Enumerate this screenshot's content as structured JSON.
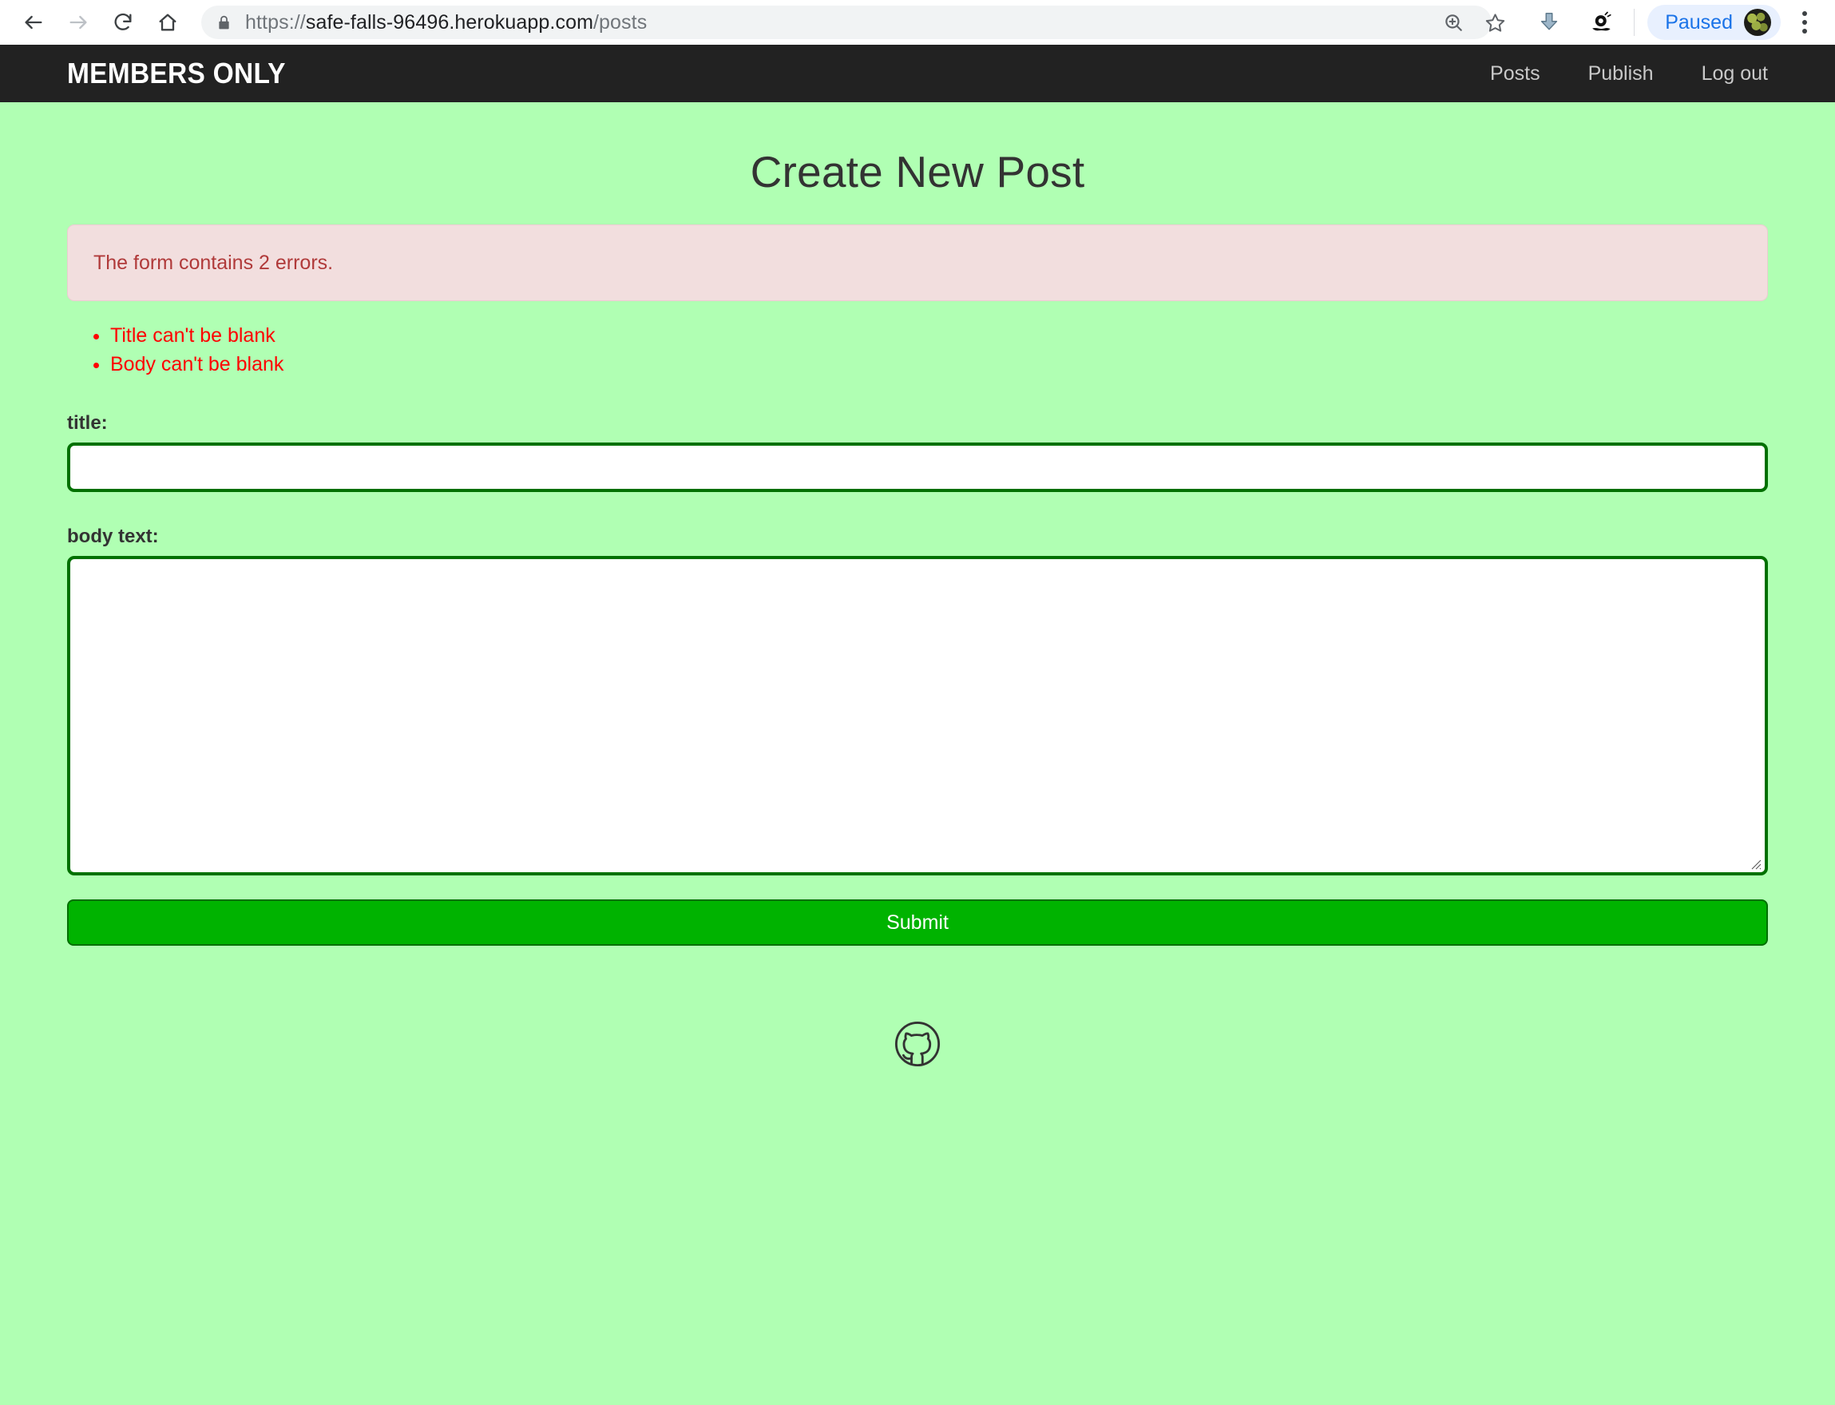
{
  "browser": {
    "back_icon": "back-arrow-icon",
    "forward_icon": "forward-arrow-icon",
    "reload_icon": "reload-icon",
    "home_icon": "home-icon",
    "lock_icon": "lock-icon",
    "url_scheme": "https://",
    "url_host": "safe-falls-96496.herokuapp.com",
    "url_path": "/posts",
    "url_full": "https://safe-falls-96496.herokuapp.com/posts",
    "zoom_icon": "zoom-in-icon",
    "bookmark_icon": "star-icon",
    "download_icon": "download-arrow-icon",
    "extension_icon": "snail-extension-icon",
    "profile_status": "Paused",
    "avatar_icon": "profile-avatar",
    "menu_icon": "kebab-menu-icon"
  },
  "site_nav": {
    "brand": "MEMBERS ONLY",
    "links": [
      {
        "label": "Posts"
      },
      {
        "label": "Publish"
      },
      {
        "label": "Log out"
      }
    ]
  },
  "main": {
    "title": "Create New Post",
    "alert_text": "The form contains 2 errors.",
    "errors": [
      "Title can't be blank",
      "Body can't be blank"
    ],
    "fields": {
      "title_label": "title:",
      "title_value": "",
      "body_label": "body text:",
      "body_value": ""
    },
    "submit_label": "Submit"
  },
  "footer": {
    "github_icon": "github-icon"
  },
  "colors": {
    "page_bg": "#b0ffb3",
    "navbar_bg": "#222222",
    "alert_bg": "#f2dede",
    "alert_text": "#b03a3a",
    "error_text": "#ff0000",
    "field_border": "#007000",
    "submit_bg": "#00b300",
    "paused_blue": "#1a73e8"
  }
}
